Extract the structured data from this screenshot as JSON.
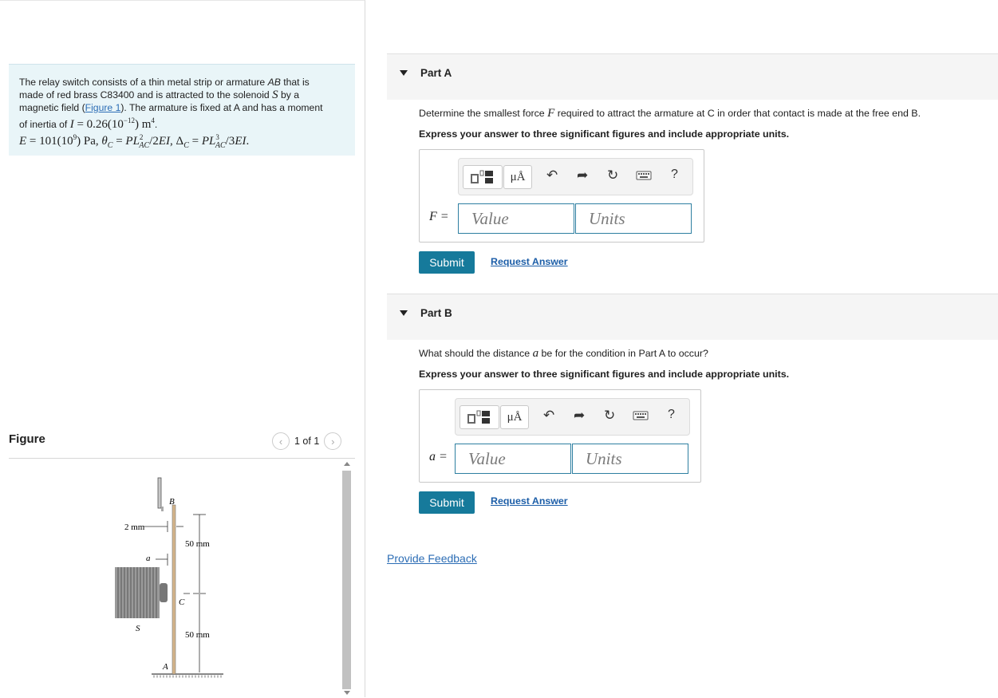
{
  "problem": {
    "line1": "The relay switch consists of a thin metal strip or armature AB that is",
    "line2": "made of red brass C83400 and is attracted to the solenoid S by a",
    "line3a": "magnetic field (",
    "figure_link": "Figure 1",
    "line3b": "). The armature is fixed at A and has a moment",
    "line4a": "of inertia of I = 0.26(10",
    "line4exp": "−12",
    "line4b": ") m",
    "line4c": "4",
    "line4d": ".",
    "formula": "E = 101(10⁹) Pa, θ_C = PL²_AC/2EI, Δ_C = PL³_AC/3EI."
  },
  "figure": {
    "title": "Figure",
    "pager": "1 of 1",
    "prev_icon": "chevron-left-icon",
    "next_icon": "chevron-right-icon",
    "labels": {
      "B": "B",
      "two_mm": "2 mm",
      "a": "a",
      "fifty1": "50 mm",
      "C": "C",
      "S": "S",
      "fifty2": "50 mm",
      "A": "A"
    }
  },
  "partA": {
    "label": "Part A",
    "question_a": "Determine the smallest force ",
    "question_var": "F",
    "question_b": " required to attract the armature at C in order that contact is made at the free end B.",
    "instruction": "Express your answer to three significant figures and include appropriate units.",
    "var_label": "F =",
    "value_placeholder": "Value",
    "units_placeholder": "Units",
    "submit": "Submit",
    "request": "Request Answer"
  },
  "partB": {
    "label": "Part B",
    "question_a": "What should the distance ",
    "question_var": "a",
    "question_b": " be for the condition in Part A to occur?",
    "instruction": "Express your answer to three significant figures and include appropriate units.",
    "var_label": "a =",
    "value_placeholder": "Value",
    "units_placeholder": "Units",
    "submit": "Submit",
    "request": "Request Answer"
  },
  "toolbar": {
    "units_btn": "μÅ",
    "help": "?",
    "icons": [
      "templates-icon",
      "units-icon",
      "undo-icon",
      "redo-icon",
      "reset-icon",
      "keyboard-icon",
      "help-icon"
    ]
  },
  "feedback": "Provide Feedback",
  "colors": {
    "accent": "#167a9b",
    "problem_bg": "#e9f5f8",
    "link": "#2c6db5",
    "part_bg": "#f5f5f5"
  }
}
